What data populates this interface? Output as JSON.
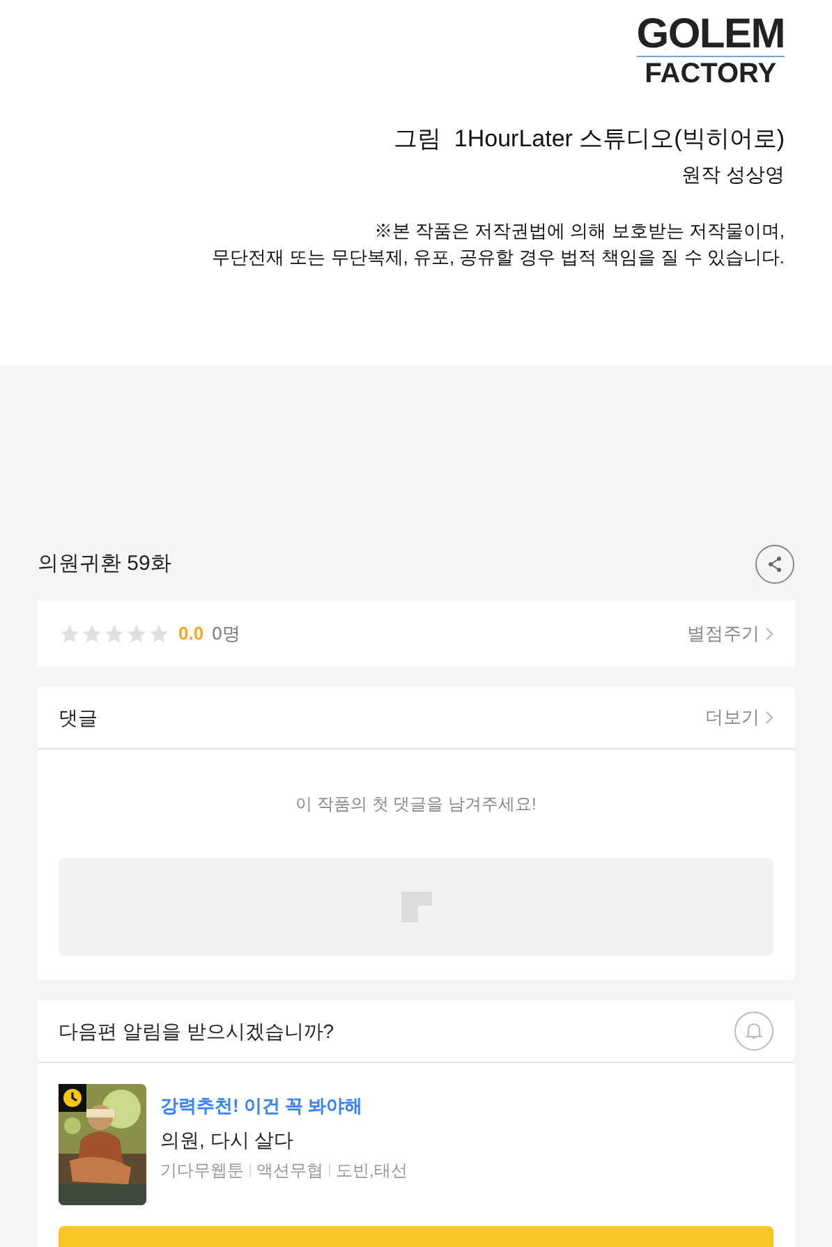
{
  "logo": {
    "line_1": "GOLEM",
    "line_2": "FACTORY"
  },
  "credits": {
    "art": "그림  1HourLater 스튜디오(빅히어로)",
    "original": "원작 성상영"
  },
  "notice": [
    "※본 작품은 저작권법에 의해 보호받는 저작물이며,",
    "무단전재 또는 무단복제, 유포, 공유할 경우 법적 책임을 질 수 있습니다."
  ],
  "episode_title": "의원귀환 59화",
  "rating": {
    "stars": 0,
    "score": "0.0",
    "count": "0명",
    "action": "별점주기"
  },
  "comments": {
    "title": "댓글",
    "more": "더보기",
    "empty_message": "이 작품의 첫 댓글을 남겨주세요!"
  },
  "notification": {
    "question": "다음편 알림을 받으시겠습니까?",
    "subscribed": false
  },
  "recommendation": {
    "tagline": "강력추천! 이건 꼭 봐야해",
    "title": "의원, 다시 살다",
    "tags": [
      "기다무웹툰",
      "액션무협",
      "도빈,태선"
    ]
  }
}
